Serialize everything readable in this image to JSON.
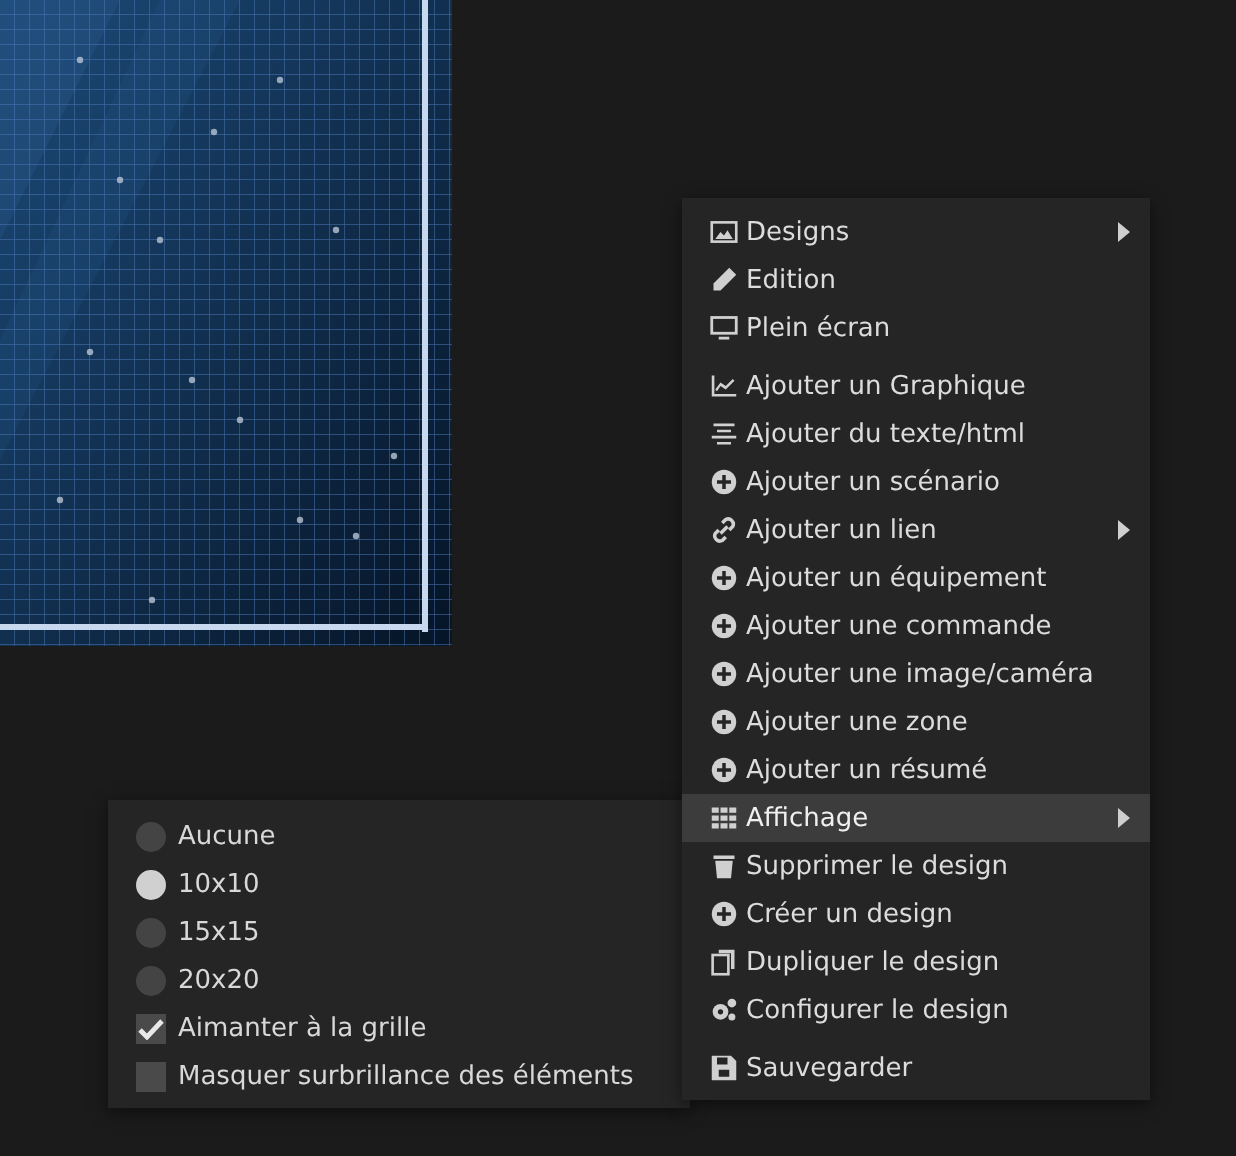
{
  "menu": {
    "groups": [
      [
        {
          "label": "Designs",
          "has_submenu": true,
          "selected": false
        },
        {
          "label": "Edition",
          "has_submenu": false,
          "selected": false
        },
        {
          "label": "Plein écran",
          "has_submenu": false,
          "selected": false
        }
      ],
      [
        {
          "label": "Ajouter un Graphique",
          "has_submenu": false,
          "selected": false
        },
        {
          "label": "Ajouter du texte/html",
          "has_submenu": false,
          "selected": false
        },
        {
          "label": "Ajouter un scénario",
          "has_submenu": false,
          "selected": false
        },
        {
          "label": "Ajouter un lien",
          "has_submenu": true,
          "selected": false
        },
        {
          "label": "Ajouter un équipement",
          "has_submenu": false,
          "selected": false
        },
        {
          "label": "Ajouter une commande",
          "has_submenu": false,
          "selected": false
        },
        {
          "label": "Ajouter une image/caméra",
          "has_submenu": false,
          "selected": false
        },
        {
          "label": "Ajouter une zone",
          "has_submenu": false,
          "selected": false
        },
        {
          "label": "Ajouter un résumé",
          "has_submenu": false,
          "selected": false
        },
        {
          "label": "Affichage",
          "has_submenu": true,
          "selected": true
        },
        {
          "label": "Supprimer le design",
          "has_submenu": false,
          "selected": false
        },
        {
          "label": "Créer un design",
          "has_submenu": false,
          "selected": false
        },
        {
          "label": "Dupliquer le design",
          "has_submenu": false,
          "selected": false
        },
        {
          "label": "Configurer le design",
          "has_submenu": false,
          "selected": false
        }
      ],
      [
        {
          "label": "Sauvegarder",
          "has_submenu": false,
          "selected": false
        }
      ]
    ]
  },
  "submenu": {
    "items": [
      {
        "kind": "radio",
        "label": "Aucune",
        "selected": false
      },
      {
        "kind": "radio",
        "label": "10x10",
        "selected": true
      },
      {
        "kind": "radio",
        "label": "15x15",
        "selected": false
      },
      {
        "kind": "radio",
        "label": "20x20",
        "selected": false
      },
      {
        "kind": "checkbox",
        "label": "Aimanter à la grille",
        "checked": true
      },
      {
        "kind": "checkbox",
        "label": "Masquer surbrillance des éléments",
        "checked": false
      }
    ]
  }
}
